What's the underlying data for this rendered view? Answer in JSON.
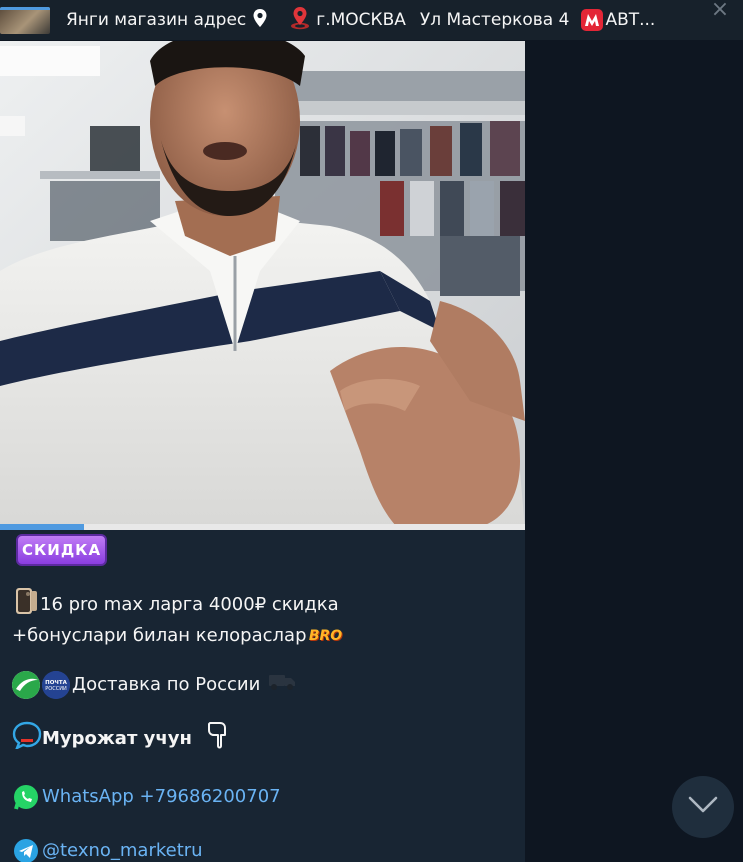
{
  "pinned": {
    "part1": "Янги магазин адрес",
    "part2": "г.МОСКВА",
    "part3": "Ул Мастеркова 4",
    "part4": "АВТ...",
    "close_glyph": "×",
    "icons": [
      "pin-marker-icon",
      "red-pin-icon",
      "metro-icon",
      "close-icon"
    ]
  },
  "video": {
    "progress_fraction": 0.16,
    "accent": "#4f9ae0"
  },
  "message": {
    "badge": "СКИДКА",
    "line1": "16 pro max ларга 4000₽ скидка",
    "line2": "+бонуслари билан келораслар",
    "bro_sticker": "BRO",
    "delivery": "Доставка по России",
    "contact_title": "Мурожат учун",
    "whatsapp": "WhatsApp +79686200707",
    "telegram": "@texno_marketru",
    "colors": {
      "link": "#6ab3f3",
      "bubble": "#182533",
      "background": "#0e1621"
    }
  },
  "scroll_button": {
    "icon": "chevron-down-icon"
  }
}
